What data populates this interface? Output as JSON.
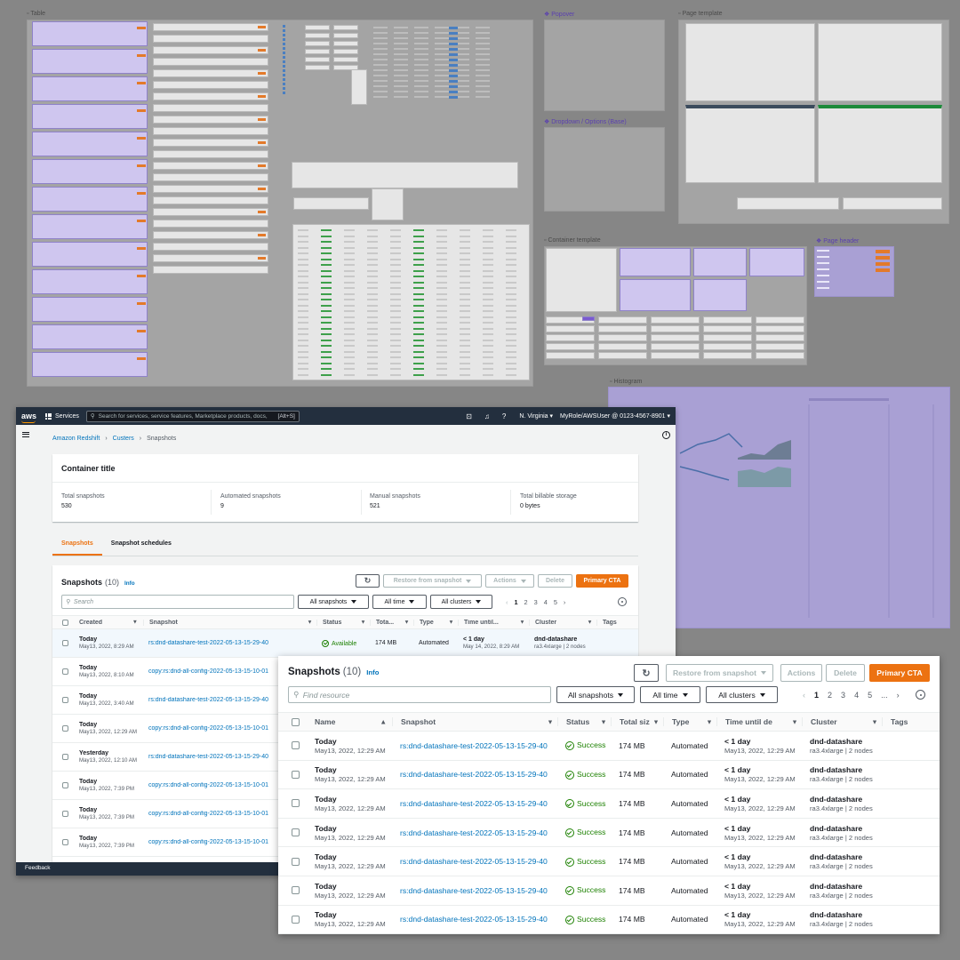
{
  "canvas": {
    "frames": {
      "table": "Table",
      "popover": "Popover",
      "page_template": "Page template",
      "dropdown": "Dropdown / Options (Base)",
      "container_template": "Container template",
      "page_header": "Page header",
      "histogram": "Histogram"
    }
  },
  "topnav": {
    "logo": "aws",
    "services": "Services",
    "search_placeholder": "Search for services, service features, Marketplace products, docs, and more",
    "search_shortcut": "[Alt+S]",
    "region": "N. Virginia",
    "user": "MyRole/AWSUser @ 0123-4567-8901",
    "icons": [
      "terminal-icon",
      "bell-icon",
      "help-icon"
    ]
  },
  "breadcrumb": [
    "Amazon Redshift",
    "Custers",
    "Snapshots"
  ],
  "container": {
    "title": "Container title",
    "stats": [
      {
        "label": "Total snapshots",
        "value": "530"
      },
      {
        "label": "Automated snapshots",
        "value": "9"
      },
      {
        "label": "Manual snapshots",
        "value": "521"
      },
      {
        "label": "Total billable storage",
        "value": "0 bytes"
      }
    ]
  },
  "tabs": [
    "Snapshots",
    "Snapshot schedules"
  ],
  "feedback": "Feedback",
  "main_table": {
    "title": "Snapshots",
    "count": "(10)",
    "info": "Info",
    "buttons": {
      "restore": "Restore from snapshot",
      "actions": "Actions",
      "delete": "Delete",
      "primary": "Primary CTA"
    },
    "search_placeholder": "Search",
    "filters": [
      "All snapshots",
      "All time",
      "All clusters"
    ],
    "pages": [
      "1",
      "2",
      "3",
      "4",
      "5"
    ],
    "columns": [
      "Created",
      "Snapshot",
      "Status",
      "Tota...",
      "Type",
      "Time until...",
      "Cluster",
      "Tags"
    ],
    "rows": [
      {
        "day": "Today",
        "date": "May13, 2022, 8:29 AM",
        "snapshot": "rs:dnd-datashare-test-2022-05-13-15-29-40",
        "status": "Available",
        "size": "174 MB",
        "type": "Automated",
        "time": "< 1 day",
        "time_sub": "May 14, 2022, 8:29 AM",
        "cluster": "dnd-datashare",
        "cluster_sub": "ra3.4xlarge | 2 nodes"
      },
      {
        "day": "Today",
        "date": "May13, 2022, 8:10 AM",
        "snapshot": "copy:rs:dnd-all-config-2022-05-13-15-10-01"
      },
      {
        "day": "Today",
        "date": "May13, 2022, 3:40 AM",
        "snapshot": "rs:dnd-datashare-test-2022-05-13-15-29-40"
      },
      {
        "day": "Today",
        "date": "May13, 2022, 12:29 AM",
        "snapshot": "copy:rs:dnd-all-config-2022-05-13-15-10-01"
      },
      {
        "day": "Yesterday",
        "date": "May13, 2022, 12:10 AM",
        "snapshot": "rs:dnd-datashare-test-2022-05-13-15-29-40"
      },
      {
        "day": "Today",
        "date": "May13, 2022, 7:39 PM",
        "snapshot": "copy:rs:dnd-all-config-2022-05-13-15-10-01"
      },
      {
        "day": "Today",
        "date": "May13, 2022, 7:39 PM",
        "snapshot": "copy:rs:dnd-all-config-2022-05-13-15-10-01"
      },
      {
        "day": "Today",
        "date": "May13, 2022, 7:39 PM",
        "snapshot": "copy:rs:dnd-all-config-2022-05-13-15-10-01"
      }
    ]
  },
  "zoom_table": {
    "title": "Snapshots",
    "count": "(10)",
    "info": "Info",
    "buttons": {
      "restore": "Restore from snapshot",
      "actions": "Actions",
      "delete": "Delete",
      "primary": "Primary CTA"
    },
    "search_placeholder": "Find resource",
    "filters": [
      "All snapshots",
      "All time",
      "All clusters"
    ],
    "pages": [
      "1",
      "2",
      "3",
      "4",
      "5"
    ],
    "ellipsis": "...",
    "columns": [
      "Name",
      "Snapshot",
      "Status",
      "Total siz",
      "Type",
      "Time until de",
      "Cluster",
      "Tags"
    ],
    "rows": [
      {
        "day": "Today",
        "date": "May13, 2022, 12:29 AM",
        "snapshot": "rs:dnd-datashare-test-2022-05-13-15-29-40",
        "status": "Success",
        "size": "174 MB",
        "type": "Automated",
        "time": "< 1 day",
        "time_sub": "May13, 2022, 12:29 AM",
        "cluster": "dnd-datashare",
        "cluster_sub": "ra3.4xlarge | 2 nodes"
      },
      {
        "day": "Today",
        "date": "May13, 2022, 12:29 AM",
        "snapshot": "rs:dnd-datashare-test-2022-05-13-15-29-40",
        "status": "Success",
        "size": "174 MB",
        "type": "Automated",
        "time": "< 1 day",
        "time_sub": "May13, 2022, 12:29 AM",
        "cluster": "dnd-datashare",
        "cluster_sub": "ra3.4xlarge | 2 nodes"
      },
      {
        "day": "Today",
        "date": "May13, 2022, 12:29 AM",
        "snapshot": "rs:dnd-datashare-test-2022-05-13-15-29-40",
        "status": "Success",
        "size": "174 MB",
        "type": "Automated",
        "time": "< 1 day",
        "time_sub": "May13, 2022, 12:29 AM",
        "cluster": "dnd-datashare",
        "cluster_sub": "ra3.4xlarge | 2 nodes"
      },
      {
        "day": "Today",
        "date": "May13, 2022, 12:29 AM",
        "snapshot": "rs:dnd-datashare-test-2022-05-13-15-29-40",
        "status": "Success",
        "size": "174 MB",
        "type": "Automated",
        "time": "< 1 day",
        "time_sub": "May13, 2022, 12:29 AM",
        "cluster": "dnd-datashare",
        "cluster_sub": "ra3.4xlarge | 2 nodes"
      },
      {
        "day": "Today",
        "date": "May13, 2022, 12:29 AM",
        "snapshot": "rs:dnd-datashare-test-2022-05-13-15-29-40",
        "status": "Success",
        "size": "174 MB",
        "type": "Automated",
        "time": "< 1 day",
        "time_sub": "May13, 2022, 12:29 AM",
        "cluster": "dnd-datashare",
        "cluster_sub": "ra3.4xlarge | 2 nodes"
      },
      {
        "day": "Today",
        "date": "May13, 2022, 12:29 AM",
        "snapshot": "rs:dnd-datashare-test-2022-05-13-15-29-40",
        "status": "Success",
        "size": "174 MB",
        "type": "Automated",
        "time": "< 1 day",
        "time_sub": "May13, 2022, 12:29 AM",
        "cluster": "dnd-datashare",
        "cluster_sub": "ra3.4xlarge | 2 nodes"
      },
      {
        "day": "Today",
        "date": "May13, 2022, 12:29 AM",
        "snapshot": "rs:dnd-datashare-test-2022-05-13-15-29-40",
        "status": "Success",
        "size": "174 MB",
        "type": "Automated",
        "time": "< 1 day",
        "time_sub": "May13, 2022, 12:29 AM",
        "cluster": "dnd-datashare",
        "cluster_sub": "ra3.4xlarge | 2 nodes"
      }
    ]
  },
  "colors": {
    "nav": "#232f3e",
    "primary": "#ec7211",
    "link": "#0073bb",
    "success": "#1d8102",
    "canvas": "#868686",
    "frame_purple": "#a9a0d4"
  }
}
